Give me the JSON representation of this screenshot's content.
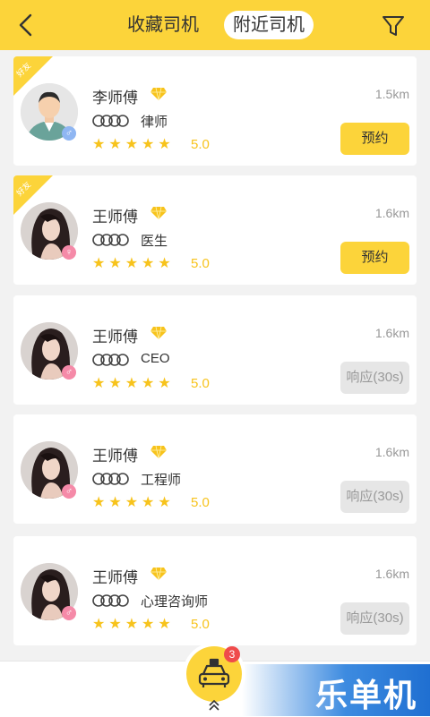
{
  "header": {
    "tab_favorites": "收藏司机",
    "tab_nearby": "附近司机"
  },
  "drivers": [
    {
      "name": "李师傅",
      "profession": "律师",
      "rating": "5.0",
      "distance": "1.5km",
      "button": "预约",
      "button_state": "primary",
      "ribbon": "好友",
      "gender": "male",
      "avatar": "male-avatar"
    },
    {
      "name": "王师傅",
      "profession": "医生",
      "rating": "5.0",
      "distance": "1.6km",
      "button": "预约",
      "button_state": "primary",
      "ribbon": "好友",
      "gender": "female",
      "avatar": "female-avatar"
    },
    {
      "name": "王师傅",
      "profession": "CEO",
      "rating": "5.0",
      "distance": "1.6km",
      "button": "响应(30s)",
      "button_state": "disabled",
      "ribbon": "",
      "gender": "male",
      "avatar": "female-avatar"
    },
    {
      "name": "王师傅",
      "profession": "工程师",
      "rating": "5.0",
      "distance": "1.6km",
      "button": "响应(30s)",
      "button_state": "disabled",
      "ribbon": "",
      "gender": "male",
      "avatar": "female-avatar"
    },
    {
      "name": "王师傅",
      "profession": "心理咨询师",
      "rating": "5.0",
      "distance": "1.6km",
      "button": "响应(30s)",
      "button_state": "disabled",
      "ribbon": "",
      "gender": "male",
      "avatar": "female-avatar"
    }
  ],
  "stars": "★★★★★",
  "bottom": {
    "badge_count": "3",
    "watermark": "乐单机"
  },
  "colors": {
    "accent": "#fcd43a",
    "star": "#f7c31c",
    "badge": "#ef4b4b"
  }
}
